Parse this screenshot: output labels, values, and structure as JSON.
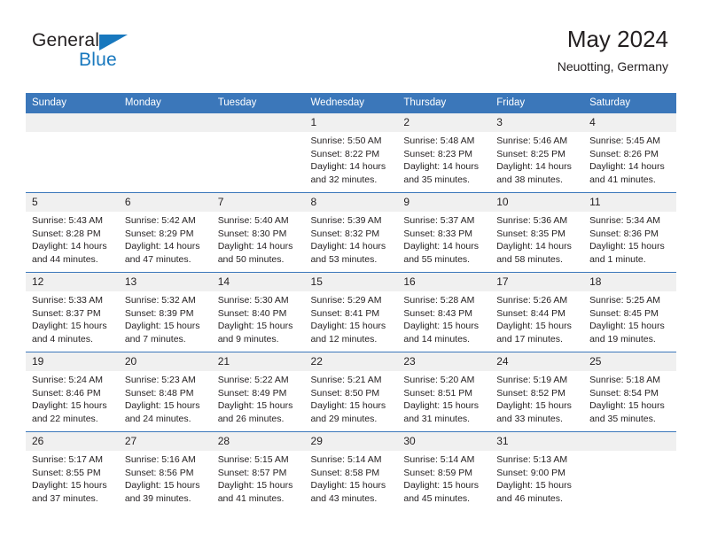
{
  "logo": {
    "word_top": "General",
    "word_bottom": "Blue",
    "triangle_icon": "triangle-icon",
    "accent_color": "#1878be"
  },
  "header": {
    "title": "May 2024",
    "subtitle": "Neuotting, Germany"
  },
  "theme": {
    "header_blue": "#3b77ba",
    "daynum_band": "#f0f0f0",
    "text": "#231f20"
  },
  "calendar": {
    "weekday_headers": [
      "Sunday",
      "Monday",
      "Tuesday",
      "Wednesday",
      "Thursday",
      "Friday",
      "Saturday"
    ],
    "weeks": [
      [
        {
          "day": "",
          "sunrise": "",
          "sunset": "",
          "daylight1": "",
          "daylight2": ""
        },
        {
          "day": "",
          "sunrise": "",
          "sunset": "",
          "daylight1": "",
          "daylight2": ""
        },
        {
          "day": "",
          "sunrise": "",
          "sunset": "",
          "daylight1": "",
          "daylight2": ""
        },
        {
          "day": "1",
          "sunrise": "Sunrise: 5:50 AM",
          "sunset": "Sunset: 8:22 PM",
          "daylight1": "Daylight: 14 hours",
          "daylight2": "and 32 minutes."
        },
        {
          "day": "2",
          "sunrise": "Sunrise: 5:48 AM",
          "sunset": "Sunset: 8:23 PM",
          "daylight1": "Daylight: 14 hours",
          "daylight2": "and 35 minutes."
        },
        {
          "day": "3",
          "sunrise": "Sunrise: 5:46 AM",
          "sunset": "Sunset: 8:25 PM",
          "daylight1": "Daylight: 14 hours",
          "daylight2": "and 38 minutes."
        },
        {
          "day": "4",
          "sunrise": "Sunrise: 5:45 AM",
          "sunset": "Sunset: 8:26 PM",
          "daylight1": "Daylight: 14 hours",
          "daylight2": "and 41 minutes."
        }
      ],
      [
        {
          "day": "5",
          "sunrise": "Sunrise: 5:43 AM",
          "sunset": "Sunset: 8:28 PM",
          "daylight1": "Daylight: 14 hours",
          "daylight2": "and 44 minutes."
        },
        {
          "day": "6",
          "sunrise": "Sunrise: 5:42 AM",
          "sunset": "Sunset: 8:29 PM",
          "daylight1": "Daylight: 14 hours",
          "daylight2": "and 47 minutes."
        },
        {
          "day": "7",
          "sunrise": "Sunrise: 5:40 AM",
          "sunset": "Sunset: 8:30 PM",
          "daylight1": "Daylight: 14 hours",
          "daylight2": "and 50 minutes."
        },
        {
          "day": "8",
          "sunrise": "Sunrise: 5:39 AM",
          "sunset": "Sunset: 8:32 PM",
          "daylight1": "Daylight: 14 hours",
          "daylight2": "and 53 minutes."
        },
        {
          "day": "9",
          "sunrise": "Sunrise: 5:37 AM",
          "sunset": "Sunset: 8:33 PM",
          "daylight1": "Daylight: 14 hours",
          "daylight2": "and 55 minutes."
        },
        {
          "day": "10",
          "sunrise": "Sunrise: 5:36 AM",
          "sunset": "Sunset: 8:35 PM",
          "daylight1": "Daylight: 14 hours",
          "daylight2": "and 58 minutes."
        },
        {
          "day": "11",
          "sunrise": "Sunrise: 5:34 AM",
          "sunset": "Sunset: 8:36 PM",
          "daylight1": "Daylight: 15 hours",
          "daylight2": "and 1 minute."
        }
      ],
      [
        {
          "day": "12",
          "sunrise": "Sunrise: 5:33 AM",
          "sunset": "Sunset: 8:37 PM",
          "daylight1": "Daylight: 15 hours",
          "daylight2": "and 4 minutes."
        },
        {
          "day": "13",
          "sunrise": "Sunrise: 5:32 AM",
          "sunset": "Sunset: 8:39 PM",
          "daylight1": "Daylight: 15 hours",
          "daylight2": "and 7 minutes."
        },
        {
          "day": "14",
          "sunrise": "Sunrise: 5:30 AM",
          "sunset": "Sunset: 8:40 PM",
          "daylight1": "Daylight: 15 hours",
          "daylight2": "and 9 minutes."
        },
        {
          "day": "15",
          "sunrise": "Sunrise: 5:29 AM",
          "sunset": "Sunset: 8:41 PM",
          "daylight1": "Daylight: 15 hours",
          "daylight2": "and 12 minutes."
        },
        {
          "day": "16",
          "sunrise": "Sunrise: 5:28 AM",
          "sunset": "Sunset: 8:43 PM",
          "daylight1": "Daylight: 15 hours",
          "daylight2": "and 14 minutes."
        },
        {
          "day": "17",
          "sunrise": "Sunrise: 5:26 AM",
          "sunset": "Sunset: 8:44 PM",
          "daylight1": "Daylight: 15 hours",
          "daylight2": "and 17 minutes."
        },
        {
          "day": "18",
          "sunrise": "Sunrise: 5:25 AM",
          "sunset": "Sunset: 8:45 PM",
          "daylight1": "Daylight: 15 hours",
          "daylight2": "and 19 minutes."
        }
      ],
      [
        {
          "day": "19",
          "sunrise": "Sunrise: 5:24 AM",
          "sunset": "Sunset: 8:46 PM",
          "daylight1": "Daylight: 15 hours",
          "daylight2": "and 22 minutes."
        },
        {
          "day": "20",
          "sunrise": "Sunrise: 5:23 AM",
          "sunset": "Sunset: 8:48 PM",
          "daylight1": "Daylight: 15 hours",
          "daylight2": "and 24 minutes."
        },
        {
          "day": "21",
          "sunrise": "Sunrise: 5:22 AM",
          "sunset": "Sunset: 8:49 PM",
          "daylight1": "Daylight: 15 hours",
          "daylight2": "and 26 minutes."
        },
        {
          "day": "22",
          "sunrise": "Sunrise: 5:21 AM",
          "sunset": "Sunset: 8:50 PM",
          "daylight1": "Daylight: 15 hours",
          "daylight2": "and 29 minutes."
        },
        {
          "day": "23",
          "sunrise": "Sunrise: 5:20 AM",
          "sunset": "Sunset: 8:51 PM",
          "daylight1": "Daylight: 15 hours",
          "daylight2": "and 31 minutes."
        },
        {
          "day": "24",
          "sunrise": "Sunrise: 5:19 AM",
          "sunset": "Sunset: 8:52 PM",
          "daylight1": "Daylight: 15 hours",
          "daylight2": "and 33 minutes."
        },
        {
          "day": "25",
          "sunrise": "Sunrise: 5:18 AM",
          "sunset": "Sunset: 8:54 PM",
          "daylight1": "Daylight: 15 hours",
          "daylight2": "and 35 minutes."
        }
      ],
      [
        {
          "day": "26",
          "sunrise": "Sunrise: 5:17 AM",
          "sunset": "Sunset: 8:55 PM",
          "daylight1": "Daylight: 15 hours",
          "daylight2": "and 37 minutes."
        },
        {
          "day": "27",
          "sunrise": "Sunrise: 5:16 AM",
          "sunset": "Sunset: 8:56 PM",
          "daylight1": "Daylight: 15 hours",
          "daylight2": "and 39 minutes."
        },
        {
          "day": "28",
          "sunrise": "Sunrise: 5:15 AM",
          "sunset": "Sunset: 8:57 PM",
          "daylight1": "Daylight: 15 hours",
          "daylight2": "and 41 minutes."
        },
        {
          "day": "29",
          "sunrise": "Sunrise: 5:14 AM",
          "sunset": "Sunset: 8:58 PM",
          "daylight1": "Daylight: 15 hours",
          "daylight2": "and 43 minutes."
        },
        {
          "day": "30",
          "sunrise": "Sunrise: 5:14 AM",
          "sunset": "Sunset: 8:59 PM",
          "daylight1": "Daylight: 15 hours",
          "daylight2": "and 45 minutes."
        },
        {
          "day": "31",
          "sunrise": "Sunrise: 5:13 AM",
          "sunset": "Sunset: 9:00 PM",
          "daylight1": "Daylight: 15 hours",
          "daylight2": "and 46 minutes."
        },
        {
          "day": "",
          "sunrise": "",
          "sunset": "",
          "daylight1": "",
          "daylight2": ""
        }
      ]
    ]
  }
}
